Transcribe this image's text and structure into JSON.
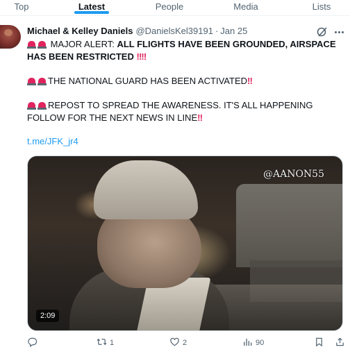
{
  "tabs": [
    {
      "label": "Top"
    },
    {
      "label": "Latest",
      "active": true
    },
    {
      "label": "People"
    },
    {
      "label": "Media"
    },
    {
      "label": "Lists"
    }
  ],
  "tweet": {
    "author_name": "Michael & Kelley Daniels",
    "handle": "@DanielsKel39191",
    "separator": "·",
    "date": "Jan 25",
    "line1_lead": "MAJOR ALERT: ",
    "line1_bold": "ALL FLIGHTS HAVE BEEN GROUNDED, AIRSPACE",
    "line2_bold": "HAS BEEN RESTRICTED",
    "para2": "THE NATIONAL GUARD HAS BEEN ACTIVATED",
    "para3_line1": "REPOST TO SPREAD THE AWARENESS. IT'S ALL HAPPENING",
    "para3_line2": "FOLLOW FOR THE NEXT NEWS IN LINE",
    "link": "t.me/JFK_jr4",
    "emphasis": "‼",
    "video": {
      "watermark": "@AANON55",
      "duration": "2:09"
    }
  },
  "actions": {
    "replies": "",
    "reposts": "1",
    "likes": "2",
    "views": "90"
  },
  "icons": {
    "reply": "reply-icon",
    "repost": "repost-icon",
    "like": "heart-icon",
    "views": "views-icon",
    "bookmark": "bookmark-icon",
    "share": "share-icon",
    "grok": "grok-icon",
    "more": "more-icon",
    "siren": "rotating-light-icon"
  },
  "colors": {
    "accent": "#1d9bf0",
    "text": "#0f1419",
    "secondary": "#536471",
    "alert": "#e0245e"
  }
}
